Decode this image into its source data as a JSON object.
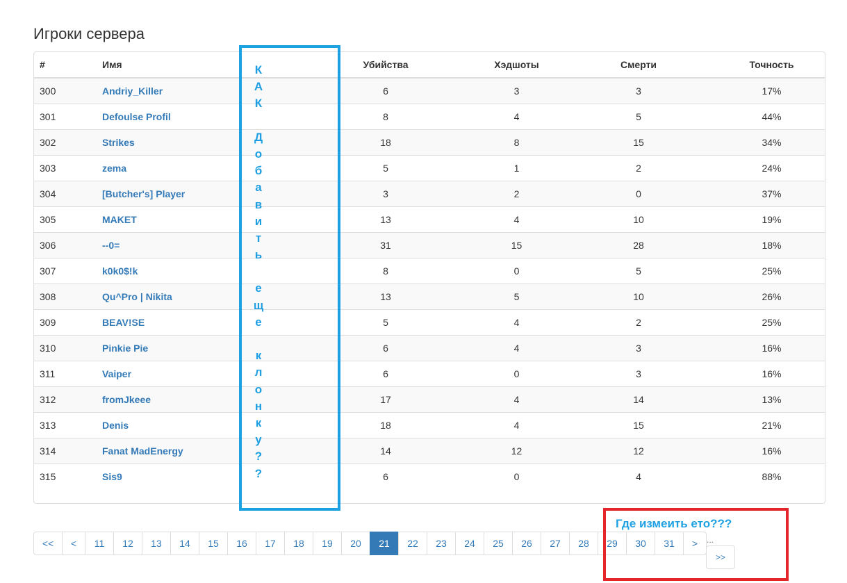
{
  "page": {
    "title": "Игроки сервера"
  },
  "table": {
    "headers": {
      "num": "#",
      "name": "Имя",
      "kills": "Убийства",
      "headshots": "Хэдшоты",
      "deaths": "Смерти",
      "accuracy": "Точность"
    },
    "rows": [
      {
        "num": "300",
        "name": "Andriy_Killer",
        "kills": "6",
        "headshots": "3",
        "deaths": "3",
        "accuracy": "17%"
      },
      {
        "num": "301",
        "name": "Defoulse Profil",
        "kills": "8",
        "headshots": "4",
        "deaths": "5",
        "accuracy": "44%"
      },
      {
        "num": "302",
        "name": "Strikes",
        "kills": "18",
        "headshots": "8",
        "deaths": "15",
        "accuracy": "34%"
      },
      {
        "num": "303",
        "name": "zema",
        "kills": "5",
        "headshots": "1",
        "deaths": "2",
        "accuracy": "24%"
      },
      {
        "num": "304",
        "name": "[Butcher's] Player",
        "kills": "3",
        "headshots": "2",
        "deaths": "0",
        "accuracy": "37%"
      },
      {
        "num": "305",
        "name": "MAKET",
        "kills": "13",
        "headshots": "4",
        "deaths": "10",
        "accuracy": "19%"
      },
      {
        "num": "306",
        "name": "--0=",
        "kills": "31",
        "headshots": "15",
        "deaths": "28",
        "accuracy": "18%"
      },
      {
        "num": "307",
        "name": "k0k0$!k",
        "kills": "8",
        "headshots": "0",
        "deaths": "5",
        "accuracy": "25%"
      },
      {
        "num": "308",
        "name": "Qu^Pro | Nikita",
        "kills": "13",
        "headshots": "5",
        "deaths": "10",
        "accuracy": "26%"
      },
      {
        "num": "309",
        "name": "BEAV!SE",
        "kills": "5",
        "headshots": "4",
        "deaths": "2",
        "accuracy": "25%"
      },
      {
        "num": "310",
        "name": "Pinkie Pie",
        "kills": "6",
        "headshots": "4",
        "deaths": "3",
        "accuracy": "16%"
      },
      {
        "num": "311",
        "name": "Vaiper",
        "kills": "6",
        "headshots": "0",
        "deaths": "3",
        "accuracy": "16%"
      },
      {
        "num": "312",
        "name": "fromJkeee",
        "kills": "17",
        "headshots": "4",
        "deaths": "14",
        "accuracy": "13%"
      },
      {
        "num": "313",
        "name": "Denis",
        "kills": "18",
        "headshots": "4",
        "deaths": "15",
        "accuracy": "21%"
      },
      {
        "num": "314",
        "name": "Fanat MadEnergy",
        "kills": "14",
        "headshots": "12",
        "deaths": "12",
        "accuracy": "16%"
      },
      {
        "num": "315",
        "name": "Sis9",
        "kills": "6",
        "headshots": "0",
        "deaths": "4",
        "accuracy": "88%"
      }
    ]
  },
  "annotation_vertical": [
    "К",
    "А",
    "К",
    " ",
    "Д",
    "о",
    "б",
    "а",
    "в",
    "и",
    "т",
    "ь",
    " ",
    "е",
    "щ",
    "е",
    " ",
    "к",
    "л",
    "о",
    "н",
    "к",
    "у",
    "?",
    "?"
  ],
  "annotation_note": "Где измеить ето???",
  "pagination": {
    "first": "<<",
    "prev": "<",
    "pages": [
      "11",
      "12",
      "13",
      "14",
      "15",
      "16",
      "17",
      "18",
      "19",
      "20",
      "21",
      "22",
      "23",
      "24",
      "25",
      "26",
      "27",
      "28",
      "29",
      "30",
      "31"
    ],
    "current": "21",
    "next": ">",
    "ellipsis": "...",
    "last": ">>"
  },
  "colors": {
    "link": "#337ab7",
    "annotation_blue": "#1ea1e3",
    "annotation_red": "#e3262b"
  }
}
